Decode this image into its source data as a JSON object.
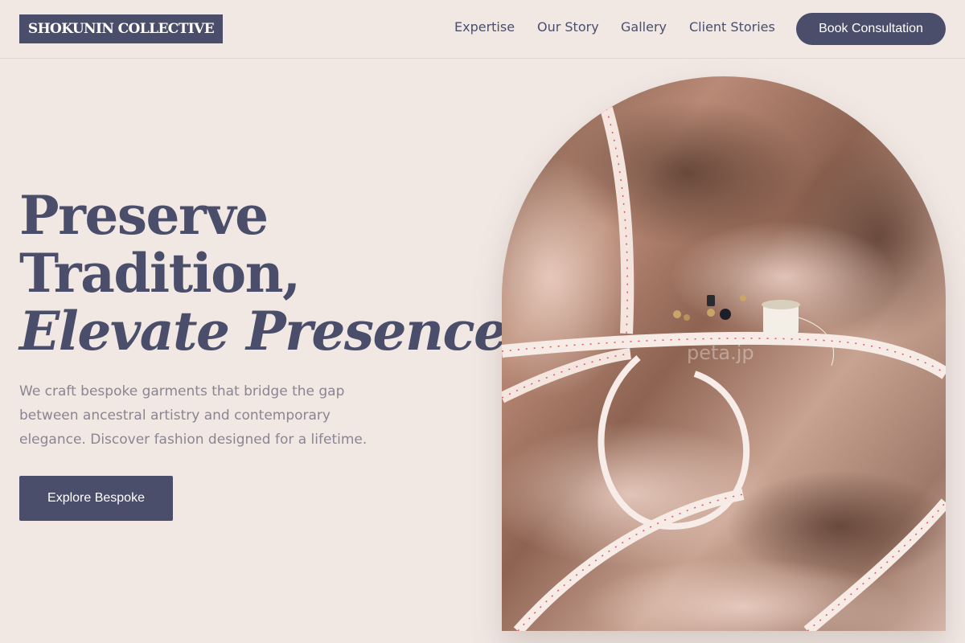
{
  "header": {
    "logo_text": "SHOKUNIN COLLECTIVE",
    "nav": [
      {
        "label": "Expertise"
      },
      {
        "label": "Our Story"
      },
      {
        "label": "Gallery"
      },
      {
        "label": "Client Stories"
      }
    ],
    "cta_label": "Book Consultation"
  },
  "hero": {
    "headline_line1": "Preserve",
    "headline_line2": "Tradition,",
    "headline_line3": "Elevate Presence.",
    "subtext": "We craft bespoke garments that bridge the gap between ancestral artistry and contemporary elegance. Discover fashion designed for a lifetime.",
    "cta_label": "Explore Bespoke",
    "image": {
      "subject": "satin fabric with measuring tape, buttons and thread spool",
      "watermark": "peta.jp"
    }
  },
  "colors": {
    "background": "#f1e8e4",
    "primary": "#4a4e6a",
    "muted_text": "#8a8592"
  }
}
